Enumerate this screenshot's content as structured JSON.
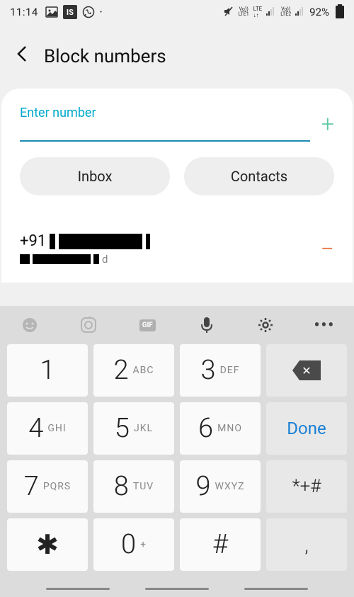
{
  "status": {
    "time": "11:14",
    "battery": "92%",
    "indicators": [
      "Vo)) LTE",
      "Vo)) LTE2"
    ],
    "is_label": "IS"
  },
  "header": {
    "title": "Block numbers"
  },
  "input": {
    "placeholder": "Enter number"
  },
  "buttons": {
    "inbox": "Inbox",
    "contacts": "Contacts"
  },
  "blocked": {
    "number_prefix": "+91",
    "redacted_number": true,
    "redacted_name": true
  },
  "keypad": {
    "keys": [
      {
        "main": "1",
        "sub": ""
      },
      {
        "main": "2",
        "sub": "ABC"
      },
      {
        "main": "3",
        "sub": "DEF"
      },
      {
        "main": "4",
        "sub": "GHI"
      },
      {
        "main": "5",
        "sub": "JKL"
      },
      {
        "main": "6",
        "sub": "MNO"
      },
      {
        "main": "7",
        "sub": "PQRS"
      },
      {
        "main": "8",
        "sub": "TUV"
      },
      {
        "main": "9",
        "sub": "WXYZ"
      },
      {
        "main": "✱",
        "sub": ""
      },
      {
        "main": "0",
        "sub": "+"
      },
      {
        "main": "#",
        "sub": ""
      }
    ],
    "done": "Done",
    "symbols": "*+#",
    "comma": ","
  }
}
